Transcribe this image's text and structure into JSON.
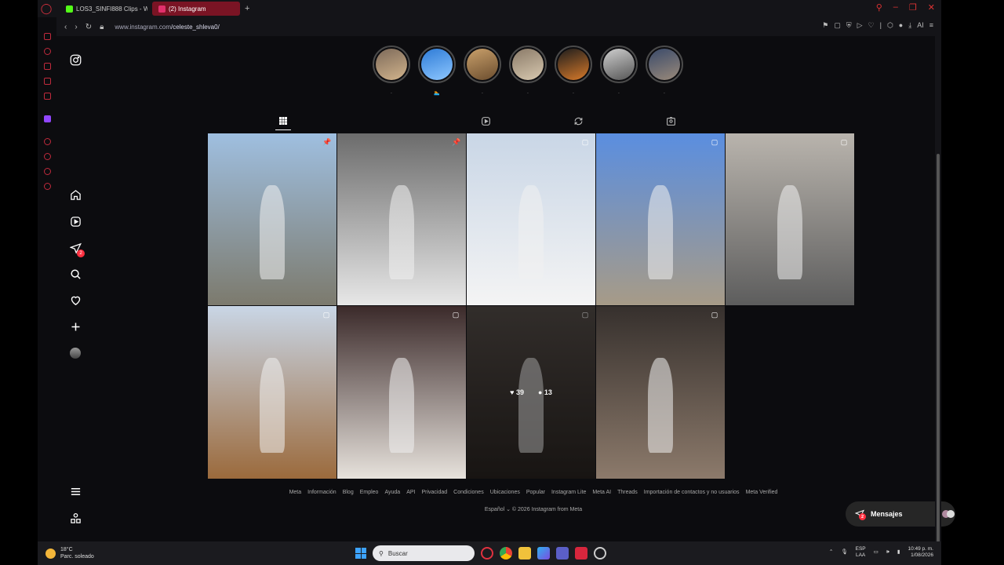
{
  "browser": {
    "tabs": [
      {
        "label": "LOS3_SINFI888 Clips - Wa",
        "color": "#53fc18"
      },
      {
        "label": "(2) Instagram",
        "color": "#e1306c"
      }
    ],
    "url_prefix": "www.instagram.com",
    "url_path": "/celeste_shleva0/",
    "ai_label": "AI"
  },
  "sidebar": {
    "items": [
      "instagram-logo",
      "home",
      "reels",
      "messages",
      "search",
      "notifications",
      "create",
      "profile"
    ],
    "messages_badge": "2"
  },
  "stories": [
    {
      "name": ".",
      "colors": [
        "#7d6a5a",
        "#d2b48c"
      ]
    },
    {
      "name": "🏊",
      "colors": [
        "#2e7bd6",
        "#8ec7ff"
      ]
    },
    {
      "name": ".",
      "colors": [
        "#c9a06b",
        "#6b4d2e"
      ]
    },
    {
      "name": ".",
      "colors": [
        "#8a7a68",
        "#d8c9b0"
      ]
    },
    {
      "name": ".",
      "colors": [
        "#1d1d1d",
        "#d87a2a"
      ]
    },
    {
      "name": ".",
      "colors": [
        "#cfcfcf",
        "#555555"
      ]
    },
    {
      "name": ".",
      "colors": [
        "#3a4a6a",
        "#9a8a7a"
      ]
    }
  ],
  "profile_tabs": [
    "posts",
    "reels",
    "reposts",
    "tagged"
  ],
  "posts": [
    {
      "alt": "woman on white car",
      "bg": [
        "#9fbfe0",
        "#7c7a6d"
      ],
      "badge": "📌"
    },
    {
      "alt": "skier black and white",
      "bg": [
        "#6c6c6c",
        "#e7e7e7"
      ],
      "badge": "📌"
    },
    {
      "alt": "two skiers",
      "bg": [
        "#c9d6e6",
        "#f4f4f4"
      ],
      "badge": "▢"
    },
    {
      "alt": "brandenburg gate",
      "bg": [
        "#5a8ee0",
        "#a79b87"
      ],
      "badge": "▢"
    },
    {
      "alt": "berlin wall",
      "bg": [
        "#b9b4ad",
        "#5d5d5d"
      ],
      "badge": "▢"
    },
    {
      "alt": "building in italy",
      "bg": [
        "#c9d6e6",
        "#9b6a3c"
      ],
      "badge": "▢"
    },
    {
      "alt": "roma collage",
      "bg": [
        "#3b2a2a",
        "#e7e2dc"
      ],
      "badge": "▢"
    },
    {
      "alt": "selfie dark room",
      "bg": [
        "#4d4642",
        "#25201d"
      ],
      "badge": "▢",
      "likes": "39",
      "comments": "13"
    },
    {
      "alt": "group selfies",
      "bg": [
        "#36302d",
        "#8c7a6b"
      ],
      "badge": "▢"
    }
  ],
  "footer": {
    "links": [
      "Meta",
      "Información",
      "Blog",
      "Empleo",
      "Ayuda",
      "API",
      "Privacidad",
      "Condiciones",
      "Ubicaciones",
      "Popular",
      "Instagram Lite",
      "Meta AI",
      "Threads",
      "Importación de contactos y no usuarios",
      "Meta Verified"
    ],
    "language": "Español",
    "copyright": "© 2026 Instagram from Meta"
  },
  "messages_button": {
    "label": "Mensajes",
    "badge": "2"
  },
  "taskbar": {
    "temp": "18°C",
    "weather": "Parc. soleado",
    "search_placeholder": "Buscar",
    "lang_top": "ESP",
    "lang_bottom": "LAA",
    "time": "10:49 p. m.",
    "date": "1/08/2026"
  }
}
